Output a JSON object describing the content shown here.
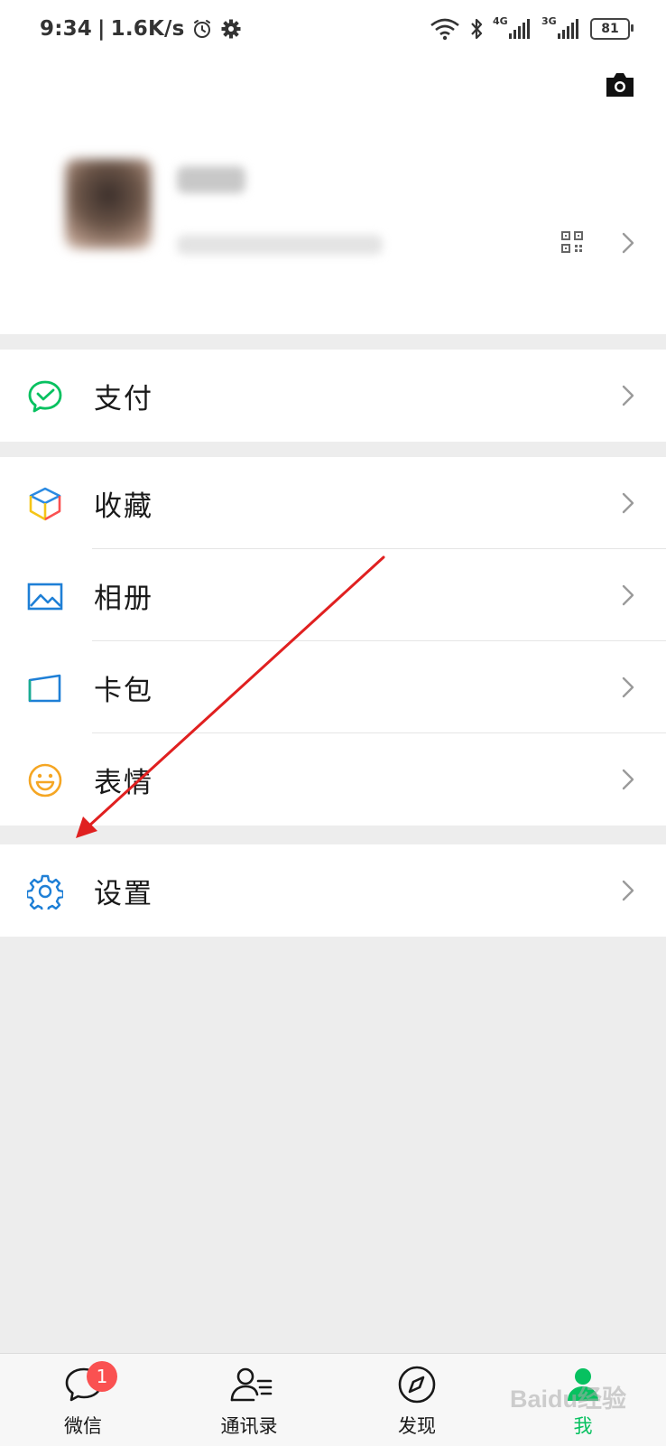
{
  "status_bar": {
    "time": "9:34",
    "net_speed": "1.6K/s",
    "signal_1": "4G",
    "signal_2": "3G",
    "battery": "81",
    "icons": [
      "alarm-icon",
      "gear-icon",
      "wifi-icon",
      "bluetooth-icon",
      "signal-icon",
      "battery-icon"
    ]
  },
  "header": {
    "camera_icon": "camera-icon"
  },
  "profile": {
    "avatar": "blurred",
    "nickname": "",
    "wechat_id": "",
    "qr_icon": "qr-code-icon"
  },
  "menu": {
    "pay": {
      "label": "支付",
      "icon": "pay-icon",
      "color": "#07c160"
    },
    "favorites": {
      "label": "收藏",
      "icon": "favorites-cube-icon"
    },
    "album": {
      "label": "相册",
      "icon": "album-icon",
      "color": "#1e7fd6"
    },
    "cards": {
      "label": "卡包",
      "icon": "card-wallet-icon",
      "color": "#1e7fd6"
    },
    "stickers": {
      "label": "表情",
      "icon": "sticker-smile-icon",
      "color": "#f5a623"
    },
    "settings": {
      "label": "设置",
      "icon": "settings-gear-icon",
      "color": "#1e7fd6"
    }
  },
  "tabbar": {
    "tabs": [
      {
        "label": "微信",
        "icon": "chat-bubble-icon",
        "badge": "1"
      },
      {
        "label": "通讯录",
        "icon": "contacts-icon"
      },
      {
        "label": "发现",
        "icon": "compass-icon"
      },
      {
        "label": "我",
        "icon": "me-icon",
        "active": true
      }
    ]
  },
  "watermark": "Baidu经验",
  "annotation": {
    "type": "red-arrow",
    "target": "settings",
    "color": "#e02020"
  }
}
